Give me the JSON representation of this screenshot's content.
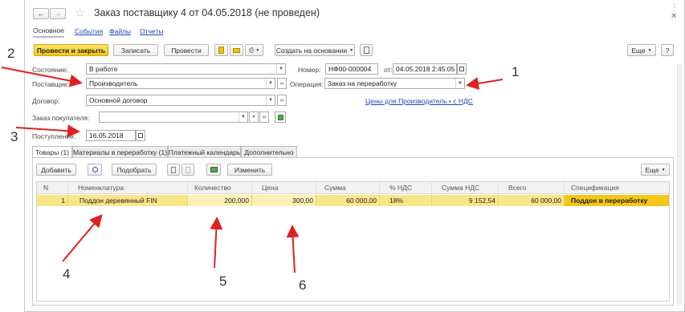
{
  "window": {
    "title": "Заказ поставщику 4 от 04.05.2018 (не проведен)",
    "nav_tabs": [
      "Основное",
      "События",
      "Файлы",
      "Отчеты"
    ]
  },
  "toolbar": {
    "post_close": "Провести и закрыть",
    "save": "Записать",
    "post": "Провести",
    "create_based_on": "Создать на основании",
    "more": "Еще",
    "help": "?"
  },
  "form": {
    "state_label": "Состояние:",
    "state_value": "В работе",
    "number_label": "Номер:",
    "number_value": "НФ00-000004",
    "date_label": "от:",
    "date_value": "04.05.2018  2:45:05",
    "supplier_label": "Поставщик:",
    "supplier_value": "Производитель",
    "operation_label": "Операция:",
    "operation_value": "Заказ на переработку",
    "contract_label": "Договор:",
    "contract_value": "Основной договор",
    "prices_link": "Цены для Производитель • с НДС",
    "customer_order_label": "Заказ покупателя:",
    "customer_order_value": "",
    "receipt_label": "Поступление:",
    "receipt_value": "16.05.2018"
  },
  "tabs": [
    "Товары (1)",
    "Материалы в переработку (1)",
    "Платежный календарь",
    "Дополнительно"
  ],
  "table_toolbar": {
    "add": "Добавить",
    "select": "Подобрать",
    "change": "Изменить",
    "more": "Еще"
  },
  "table": {
    "columns": [
      "N",
      "Номенклатура",
      "Количество",
      "Цена",
      "Сумма",
      "% НДС",
      "Сумма НДС",
      "Всего",
      "Спецификация"
    ],
    "rows": [
      [
        "1",
        "Поддон деревянный FIN",
        "200,000",
        "300,00",
        "60 000,00",
        "18%",
        "9 152,54",
        "60 000,00",
        "Поддон в переработку"
      ]
    ]
  },
  "annotations": [
    "1",
    "2",
    "3",
    "4",
    "5",
    "6"
  ],
  "colors": {
    "primary_button": "#f5c716",
    "selected_row": "#fbe58a",
    "arrow": "#e02020",
    "link": "#1a47b8"
  }
}
